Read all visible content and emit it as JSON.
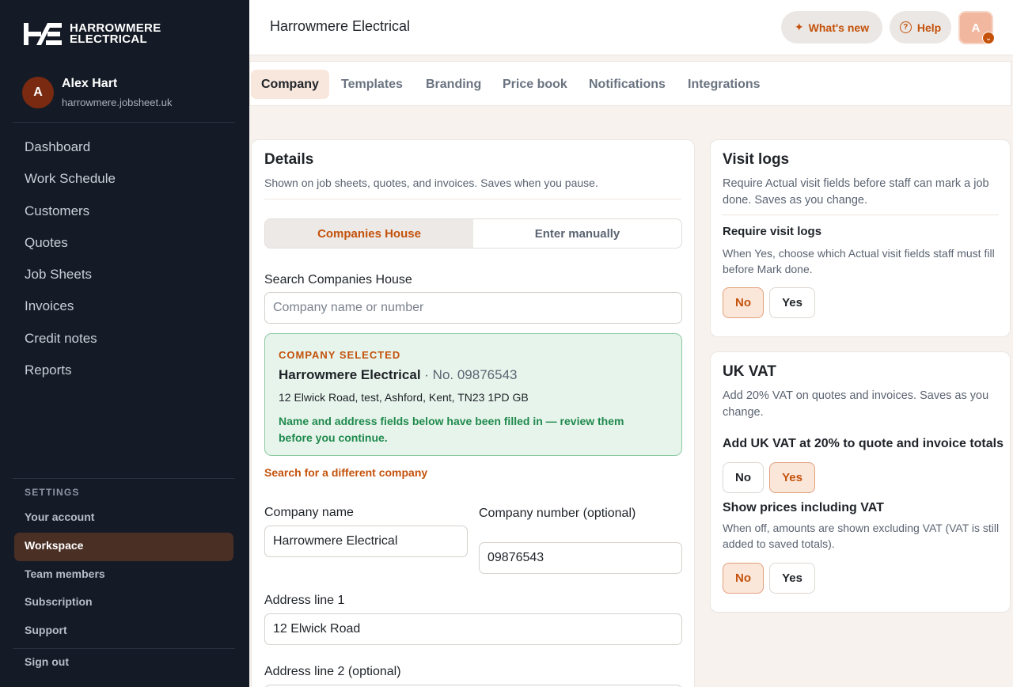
{
  "brand": {
    "logo_line1": "HARROWMERE",
    "logo_line2": "ELECTRICAL",
    "accent": "#c4520b"
  },
  "user": {
    "initial": "A",
    "name": "Alex Hart",
    "domain": "harrowmere.jobsheet.uk"
  },
  "nav": {
    "items": [
      "Dashboard",
      "Work Schedule",
      "Customers",
      "Quotes",
      "Job Sheets",
      "Invoices",
      "Credit notes",
      "Reports"
    ]
  },
  "settings": {
    "label": "SETTINGS",
    "items": [
      "Your account",
      "Workspace",
      "Team members",
      "Subscription",
      "Support"
    ],
    "active": "Workspace",
    "sign_out": "Sign out"
  },
  "header": {
    "title": "Harrowmere Electrical",
    "whats_new": "What's new",
    "help": "Help",
    "avatar_initial": "A"
  },
  "tabs": [
    "Company",
    "Templates",
    "Branding",
    "Price book",
    "Notifications",
    "Integrations"
  ],
  "details": {
    "title": "Details",
    "subtitle": "Shown on job sheets, quotes, and invoices. Saves when you pause.",
    "mode_options": [
      "Companies House",
      "Enter manually"
    ],
    "search_label": "Search Companies House",
    "search_placeholder": "Company name or number",
    "selected": {
      "tag": "COMPANY SELECTED",
      "name": "Harrowmere Electrical",
      "number": "· No. 09876543",
      "address": "12 Elwick Road, test, Ashford, Kent, TN23 1PD GB",
      "note": "Name and address fields below have been filled in — review them before you continue."
    },
    "different_link": "Search for a different company",
    "company_name_label": "Company name",
    "company_name_value": "Harrowmere Electrical",
    "company_number_label": "Company number (optional)",
    "company_number_value": "09876543",
    "address1_label": "Address line 1",
    "address1_value": "12 Elwick Road",
    "address2_label": "Address line 2 (optional)"
  },
  "visit_logs": {
    "title": "Visit logs",
    "subtitle": "Require Actual visit fields before staff can mark a job done. Saves as you change.",
    "question": "Require visit logs",
    "question_sub": "When Yes, choose which Actual visit fields staff must fill before Mark done.",
    "no": "No",
    "yes": "Yes",
    "selected": "No"
  },
  "uk_vat": {
    "title": "UK VAT",
    "subtitle": "Add 20% VAT on quotes and invoices. Saves as you change.",
    "q1": "Add UK VAT at 20% to quote and invoice totals",
    "q1_selected": "Yes",
    "q2": "Show prices including VAT",
    "q2_sub": "When off, amounts are shown excluding VAT (VAT is still added to saved totals).",
    "q2_selected": "No",
    "no": "No",
    "yes": "Yes"
  }
}
